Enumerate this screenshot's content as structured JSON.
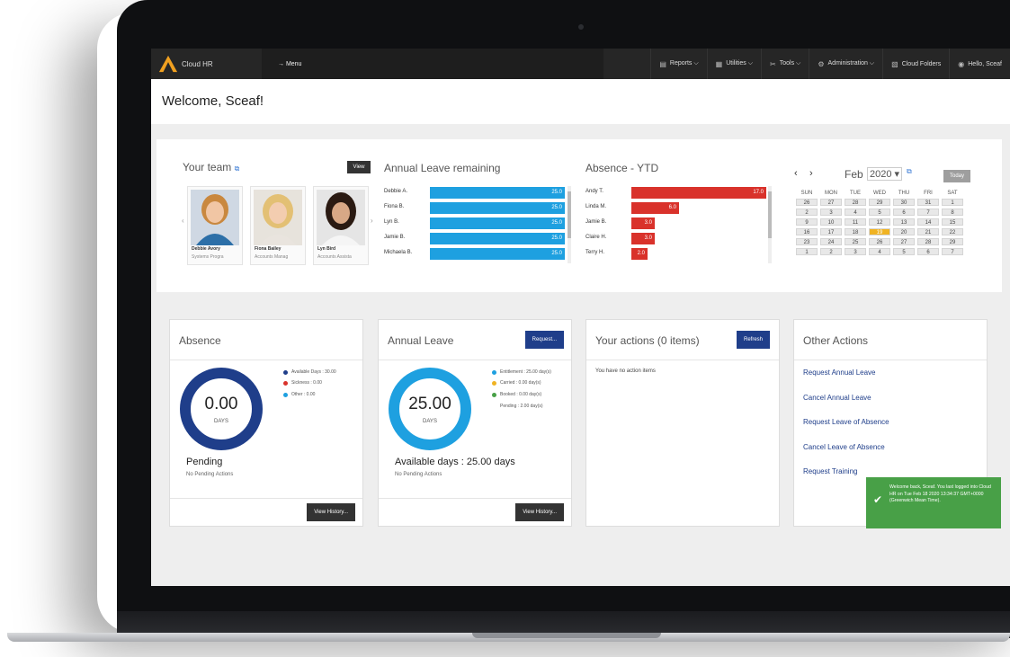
{
  "nav": {
    "brand": "Cloud HR",
    "menu": "→  Menu",
    "items": [
      {
        "icon": "report-icon",
        "glyph": "▤",
        "label": "Reports ⌵"
      },
      {
        "icon": "utilities-icon",
        "glyph": "▦",
        "label": "Utilities ⌵"
      },
      {
        "icon": "tools-icon",
        "glyph": "✂",
        "label": "Tools ⌵"
      },
      {
        "icon": "admin-icon",
        "glyph": "⚙",
        "label": "Administration ⌵"
      },
      {
        "icon": "folder-icon",
        "glyph": "▧",
        "label": "Cloud Folders"
      },
      {
        "icon": "user-icon",
        "glyph": "◉",
        "label": "Hello, Sceaf"
      }
    ]
  },
  "welcome": {
    "title": "Welcome, Sceaf!"
  },
  "team": {
    "title": "Your team",
    "view_label": "View",
    "members": [
      {
        "name": "Debbie Avory",
        "role": "Systems Progra"
      },
      {
        "name": "Fiona Bailey",
        "role": "Accounts Manag"
      },
      {
        "name": "Lyn Bird",
        "role": "Accounts Assista"
      }
    ]
  },
  "annual_leave_remaining": {
    "title": "Annual Leave remaining",
    "rows": [
      {
        "name": "Debbie A.",
        "value": 25.0,
        "label": "25.0"
      },
      {
        "name": "Fiona B.",
        "value": 25.0,
        "label": "25.0"
      },
      {
        "name": "Lyn B.",
        "value": 25.0,
        "label": "25.0"
      },
      {
        "name": "Jamie B.",
        "value": 25.0,
        "label": "25.0"
      },
      {
        "name": "Michaela B.",
        "value": 25.0,
        "label": "25.0"
      }
    ],
    "max": 25.0
  },
  "absence_ytd": {
    "title": "Absence - YTD",
    "rows": [
      {
        "name": "Andy T.",
        "value": 17.0,
        "label": "17.0"
      },
      {
        "name": "Linda M.",
        "value": 6.0,
        "label": "6.0"
      },
      {
        "name": "Jamie B.",
        "value": 3.0,
        "label": "3.0"
      },
      {
        "name": "Claire H.",
        "value": 3.0,
        "label": "3.0"
      },
      {
        "name": "Terry H.",
        "value": 2.0,
        "label": "2.0"
      }
    ],
    "max": 17.0
  },
  "calendar": {
    "prev": "‹",
    "next": "›",
    "month": "Feb",
    "year": "2020 ▾",
    "today_label": "Today",
    "weekdays": [
      "SUN",
      "MON",
      "TUE",
      "WED",
      "THU",
      "FRI",
      "SAT"
    ],
    "weeks": [
      [
        "26",
        "27",
        "28",
        "29",
        "30",
        "31",
        "1"
      ],
      [
        "2",
        "3",
        "4",
        "5",
        "6",
        "7",
        "8"
      ],
      [
        "9",
        "10",
        "11",
        "12",
        "13",
        "14",
        "15"
      ],
      [
        "16",
        "17",
        "18",
        "19",
        "20",
        "21",
        "22"
      ],
      [
        "23",
        "24",
        "25",
        "26",
        "27",
        "28",
        "29"
      ],
      [
        "1",
        "2",
        "3",
        "4",
        "5",
        "6",
        "7"
      ]
    ],
    "today": "19"
  },
  "absence_card": {
    "title": "Absence",
    "donut_value": "0.00",
    "donut_unit": "DAYS",
    "legend": [
      {
        "color": "#1f3e8a",
        "text": "Available Days : 30.00"
      },
      {
        "color": "#d9322b",
        "text": "Sickness : 0.00"
      },
      {
        "color": "#1ea0e0",
        "text": "Other : 0.00"
      }
    ],
    "pending_title": "Pending",
    "pending_sub": "No Pending Actions",
    "history_label": "View History..."
  },
  "leave_card": {
    "title": "Annual Leave",
    "request_label": "Request...",
    "donut_value": "25.00",
    "donut_unit": "DAYS",
    "legend": [
      {
        "color": "#1ea0e0",
        "text": "Entitlement : 25.00 day(s)"
      },
      {
        "color": "#f0b323",
        "text": "Carried : 0.00 day(s)"
      },
      {
        "color": "#48a047",
        "text": "Booked : 0.00 day(s)"
      },
      {
        "color": "",
        "text": "Pending : 2.00 day(s)"
      }
    ],
    "available_title": "Available days : 25.00 days",
    "pending_sub": "No Pending Actions",
    "history_label": "View History..."
  },
  "actions_card": {
    "title": "Your actions (0 items)",
    "refresh_label": "Refresh",
    "empty_text": "You have no action items"
  },
  "other_actions": {
    "title": "Other Actions",
    "links": [
      "Request Annual Leave",
      "Cancel Annual Leave",
      "Request Leave of Absence",
      "Cancel Leave of Absence",
      "Request Training"
    ]
  },
  "toast": {
    "text": "Welcome back, Sceaf. You last logged into Cloud HR on Tue Feb 18 2020 13:34:37 GMT+0000 (Greenwich Mean Time)."
  },
  "colors": {
    "accent_blue": "#1ea0e0",
    "navy": "#1f3e8a",
    "red": "#d9322b",
    "today": "#f0b323",
    "toast": "#48a047"
  }
}
